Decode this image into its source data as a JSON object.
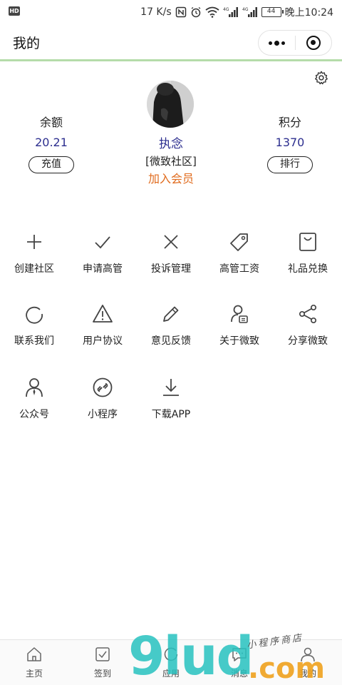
{
  "status_bar": {
    "hd": "HD",
    "speed": "17 K/s",
    "battery": "44",
    "time": "晚上10:24",
    "net_4g_1": "4G",
    "net_4g_2": "4G"
  },
  "nav": {
    "title": "我的"
  },
  "profile": {
    "name": "执念",
    "community": "[微致社区]",
    "join_member": "加入会员"
  },
  "stats": {
    "balance": {
      "label": "余额",
      "value": "20.21",
      "button": "充值"
    },
    "points": {
      "label": "积分",
      "value": "1370",
      "button": "排行"
    }
  },
  "grid": [
    {
      "label": "创建社区",
      "icon": "plus-icon"
    },
    {
      "label": "申请高管",
      "icon": "check-icon"
    },
    {
      "label": "投诉管理",
      "icon": "x-icon"
    },
    {
      "label": "高管工资",
      "icon": "tag-icon"
    },
    {
      "label": "礼品兑换",
      "icon": "shopping-bag-icon"
    },
    {
      "label": "联系我们",
      "icon": "refresh-icon"
    },
    {
      "label": "用户协议",
      "icon": "warning-icon"
    },
    {
      "label": "意见反馈",
      "icon": "pencil-icon"
    },
    {
      "label": "关于微致",
      "icon": "user-card-icon"
    },
    {
      "label": "分享微致",
      "icon": "share-icon"
    },
    {
      "label": "公众号",
      "icon": "person-icon"
    },
    {
      "label": "小程序",
      "icon": "link-circle-icon"
    },
    {
      "label": "下载APP",
      "icon": "download-icon"
    }
  ],
  "tabs": [
    {
      "label": "主页",
      "icon": "home-icon"
    },
    {
      "label": "签到",
      "icon": "checkbox-icon"
    },
    {
      "label": "应用",
      "icon": "refresh-icon"
    },
    {
      "label": "消息",
      "icon": "message-icon"
    },
    {
      "label": "我的",
      "icon": "user-icon"
    }
  ],
  "watermark": {
    "main": "9lud",
    "suffix": ".com",
    "small": "小程序商店"
  },
  "colors": {
    "accent_blue": "#2d2f8f",
    "member_orange": "#e06b1d",
    "nav_divider": "#b5dcaa"
  }
}
